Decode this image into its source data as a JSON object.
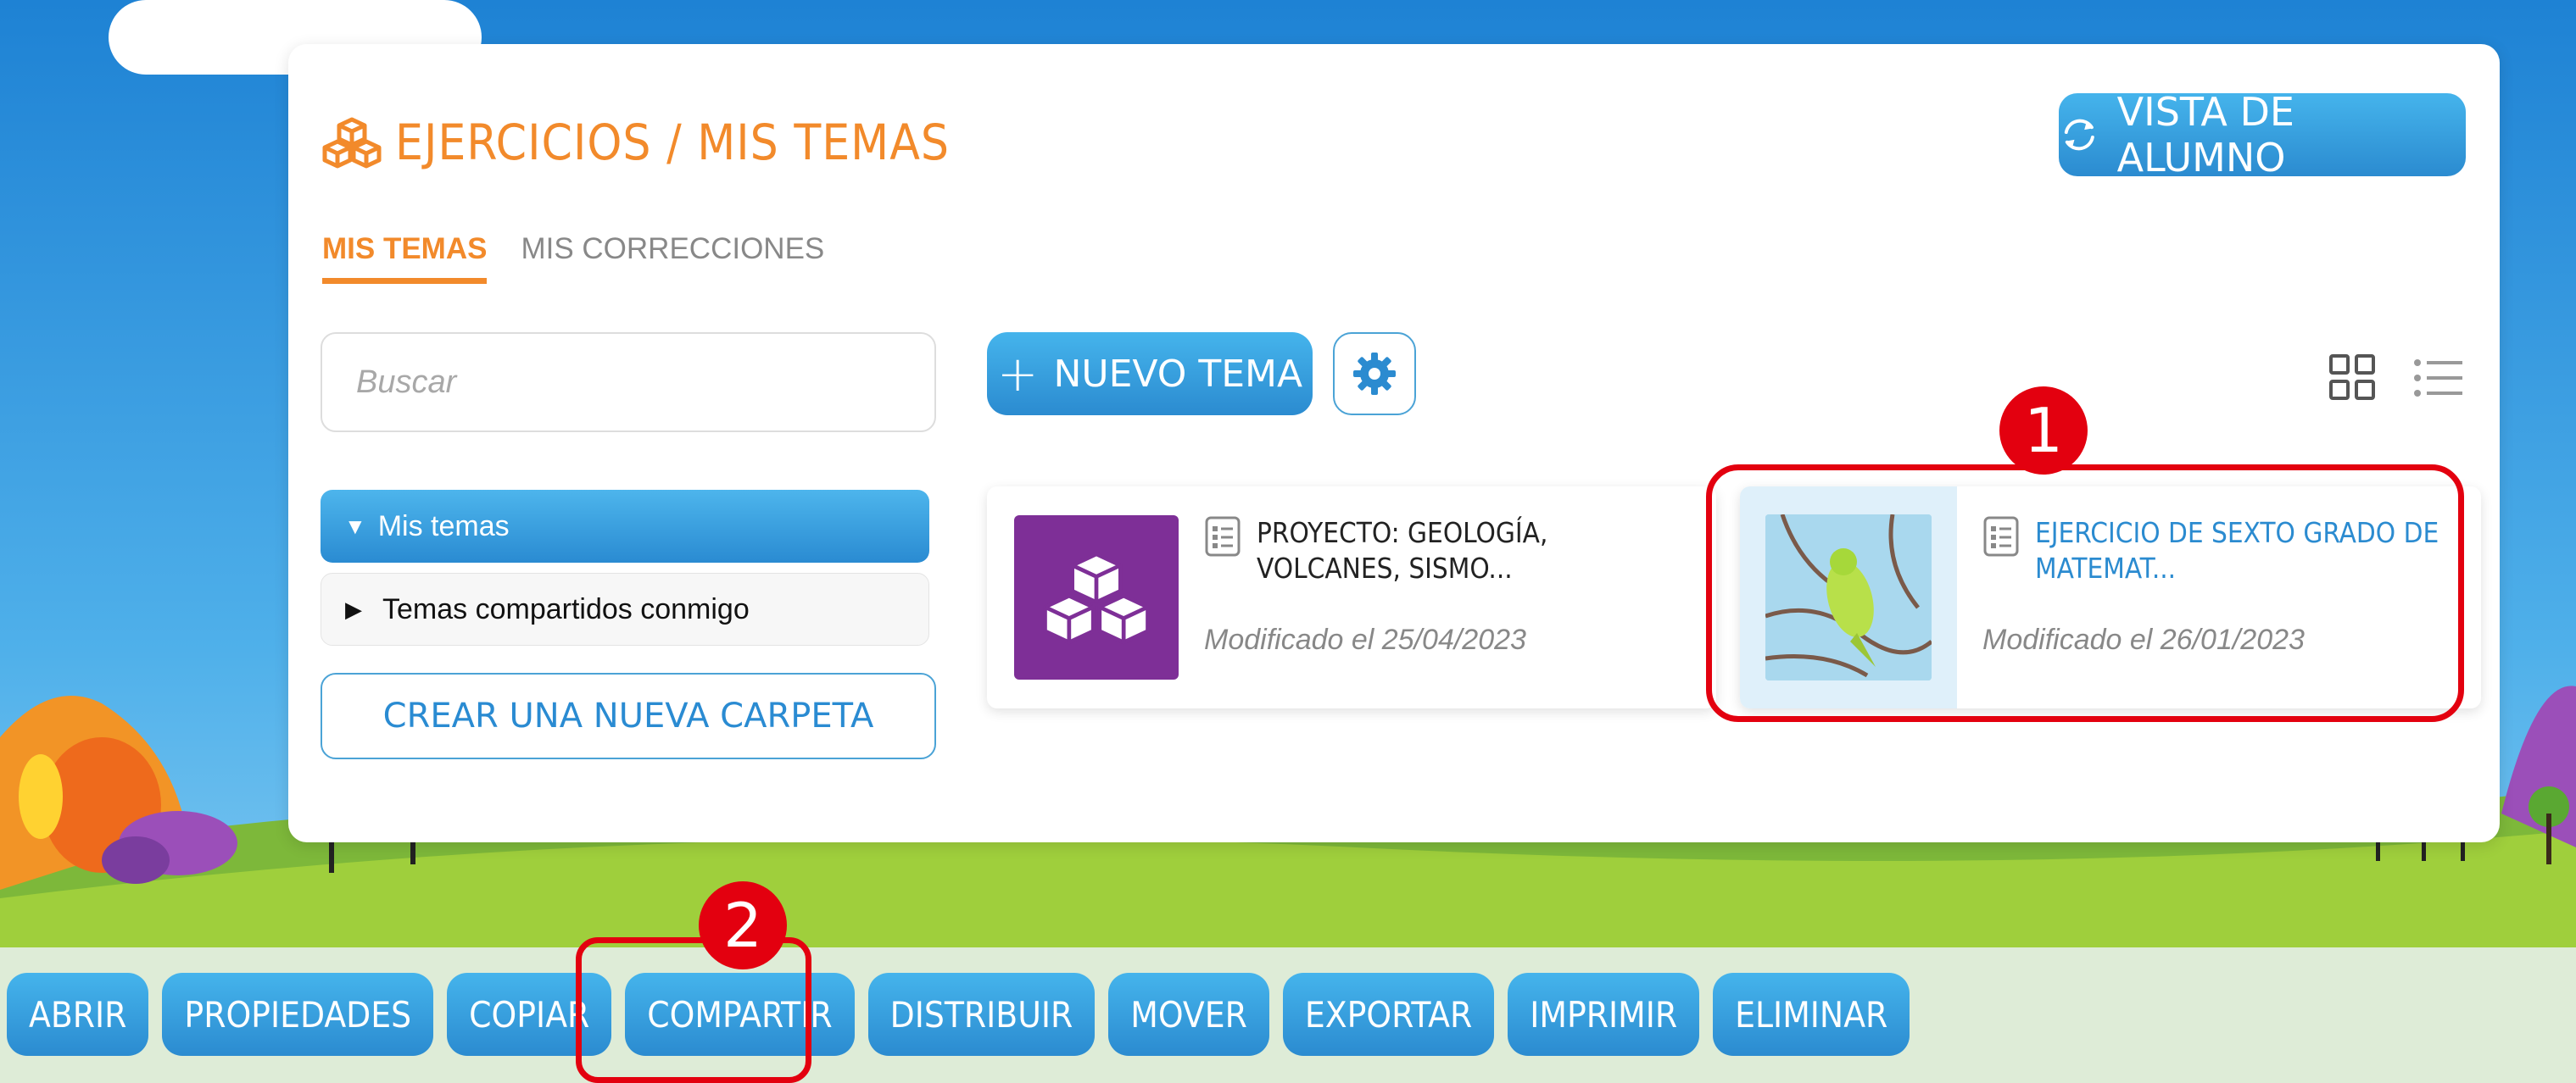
{
  "header": {
    "title": "EJERCICIOS / MIS TEMAS",
    "student_view_label": "VISTA DE ALUMNO"
  },
  "tabs": [
    {
      "label": "MIS TEMAS",
      "active": true
    },
    {
      "label": "MIS CORRECCIONES",
      "active": false
    }
  ],
  "sidebar": {
    "search_placeholder": "Buscar",
    "tree": [
      {
        "label": "Mis temas",
        "expanded": true
      },
      {
        "label": "Temas compartidos conmigo",
        "expanded": false
      }
    ],
    "new_folder_label": "CREAR UNA NUEVA CARPETA"
  },
  "toolbar": {
    "new_topic_label": "NUEVO TEMA",
    "plus": "+"
  },
  "cards": [
    {
      "title_line1": "PROYECTO: GEOLOGÍA,",
      "title_line2": "VOLCANES, SISMO...",
      "modified": "Modificado el 25/04/2023"
    },
    {
      "title_line1": "EJERCICIO DE SEXTO GRADO DE",
      "title_line2": "MATEMAT...",
      "modified": "Modificado el 26/01/2023"
    }
  ],
  "actions": [
    "ABRIR",
    "PROPIEDADES",
    "COPIAR",
    "COMPARTIR",
    "DISTRIBUIR",
    "MOVER",
    "EXPORTAR",
    "IMPRIMIR",
    "ELIMINAR"
  ],
  "annotations": [
    "1",
    "2"
  ],
  "colors": {
    "accent_orange": "#f28a2b",
    "button_blue": "#2b8bd0",
    "highlight_red": "#e3000f",
    "thumb_purple": "#7e2f97"
  }
}
